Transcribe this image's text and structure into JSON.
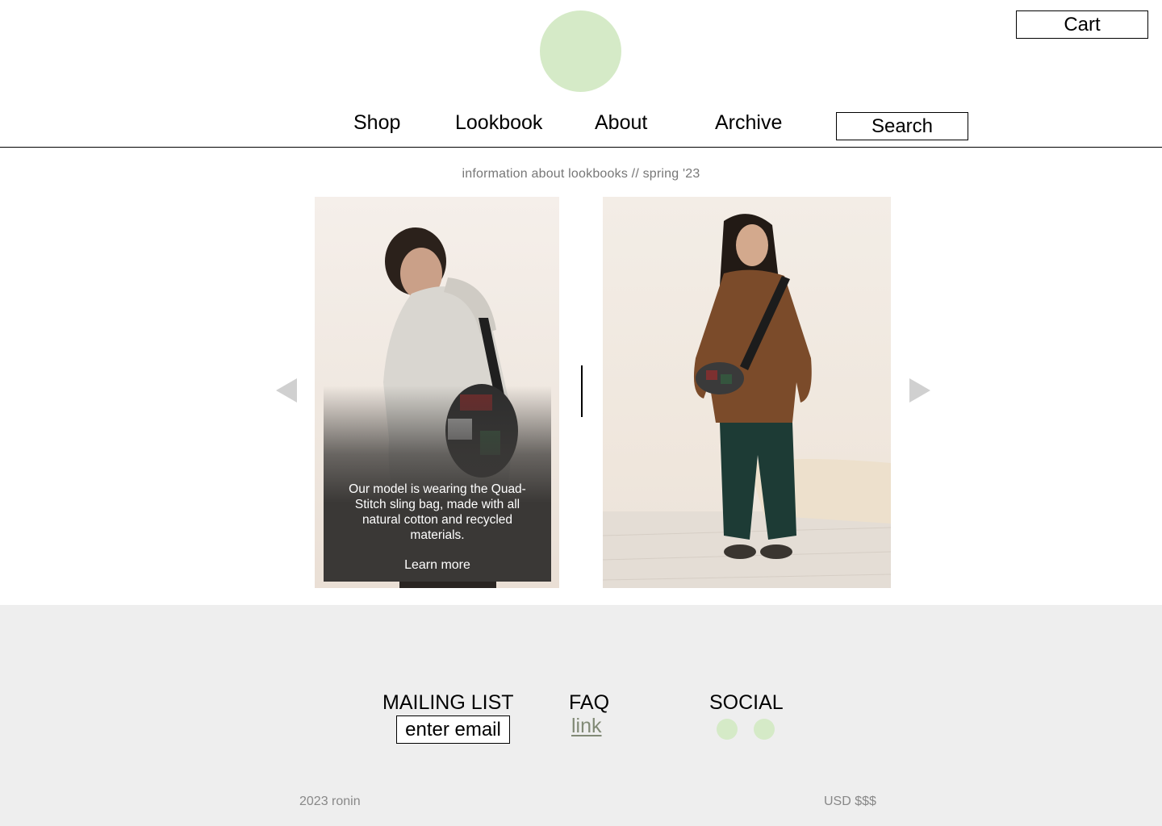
{
  "header": {
    "cart_label": "Cart",
    "nav": [
      "Shop",
      "Lookbook",
      "About",
      "Archive"
    ],
    "search_placeholder": "Search"
  },
  "lookbook": {
    "info": "information about lookbooks // spring '23",
    "overlay_text": "Our model is wearing the Quad-Stitch sling bag, made with all natural cotton and recycled materials.",
    "overlay_link": "Learn more"
  },
  "footer": {
    "mailing_heading": "MAILING LIST",
    "email_placeholder": "enter email",
    "faq_heading": "FAQ",
    "faq_link": "link",
    "social_heading": "SOCIAL",
    "copyright": "2023 ronin",
    "currency": "USD $$$"
  },
  "colors": {
    "accent": "#d5eac7",
    "footer_bg": "#eeeeee",
    "link_green": "#818a76",
    "overlay": "#3a3836"
  },
  "icons": {
    "prev": "triangle-left-icon",
    "next": "triangle-right-icon",
    "logo": "circle-logo",
    "social": [
      "social-icon",
      "social-icon"
    ]
  }
}
